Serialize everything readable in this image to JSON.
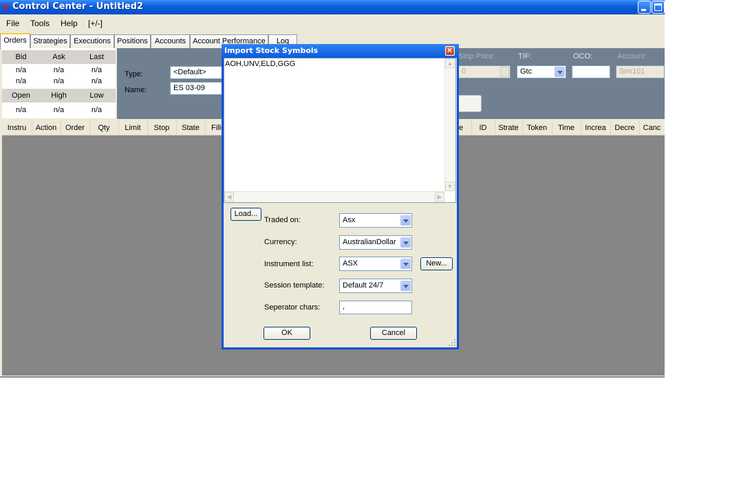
{
  "window": {
    "title": "Control Center - Untitled2",
    "colors": {
      "titlebar": "#0a5fdc",
      "grid": "#808080",
      "entry_panel": "#708090",
      "dialog_border": "#0a52d8"
    }
  },
  "menubar": {
    "items": [
      "File",
      "Tools",
      "Help",
      "[+/-]"
    ]
  },
  "tabs": [
    "Orders",
    "Strategies",
    "Executions",
    "Positions",
    "Accounts",
    "Account Performance",
    "Log"
  ],
  "quote": {
    "headers_top": [
      "Bid",
      "Ask",
      "Last"
    ],
    "rows_top": [
      [
        "n/a",
        "n/a",
        "n/a"
      ],
      [
        "n/a",
        "n/a",
        "n/a"
      ]
    ],
    "headers_bottom": [
      "Open",
      "High",
      "Low"
    ],
    "row_bottom": [
      "n/a",
      "n/a",
      "n/a"
    ]
  },
  "entry": {
    "type_label": "Type:",
    "type_value": "<Default>",
    "name_label": "Name:",
    "name_value": "ES 03-09",
    "stop_price_label": "Stop Price:",
    "stop_price_value": "0",
    "tif_label": "TIF:",
    "tif_value": "Gtc",
    "oco_label": "OCO:",
    "oco_value": "",
    "account_label": "Account:",
    "account_value": "Sim101"
  },
  "grid": {
    "columns": [
      "Instru",
      "Action",
      "Order",
      "Qty",
      "Limit",
      "Stop",
      "State",
      "Fille",
      "e",
      "ID",
      "Strate",
      "Token",
      "Time",
      "Increa",
      "Decre",
      "Canc"
    ]
  },
  "dialog": {
    "title": "Import Stock Symbols",
    "symbols_text": "AOH,UNV,ELD,GGG",
    "load_button": "Load...",
    "traded_on_label": "Traded on:",
    "traded_on_value": "Asx",
    "currency_label": "Currency:",
    "currency_value": "AustralianDollar",
    "instrument_list_label": "Instrument list:",
    "instrument_list_value": "ASX",
    "new_button": "New...",
    "session_template_label": "Session template:",
    "session_template_value": "Default 24/7",
    "separator_label": "Seperator chars:",
    "separator_value": ",",
    "ok_button": "OK",
    "cancel_button": "Cancel"
  }
}
